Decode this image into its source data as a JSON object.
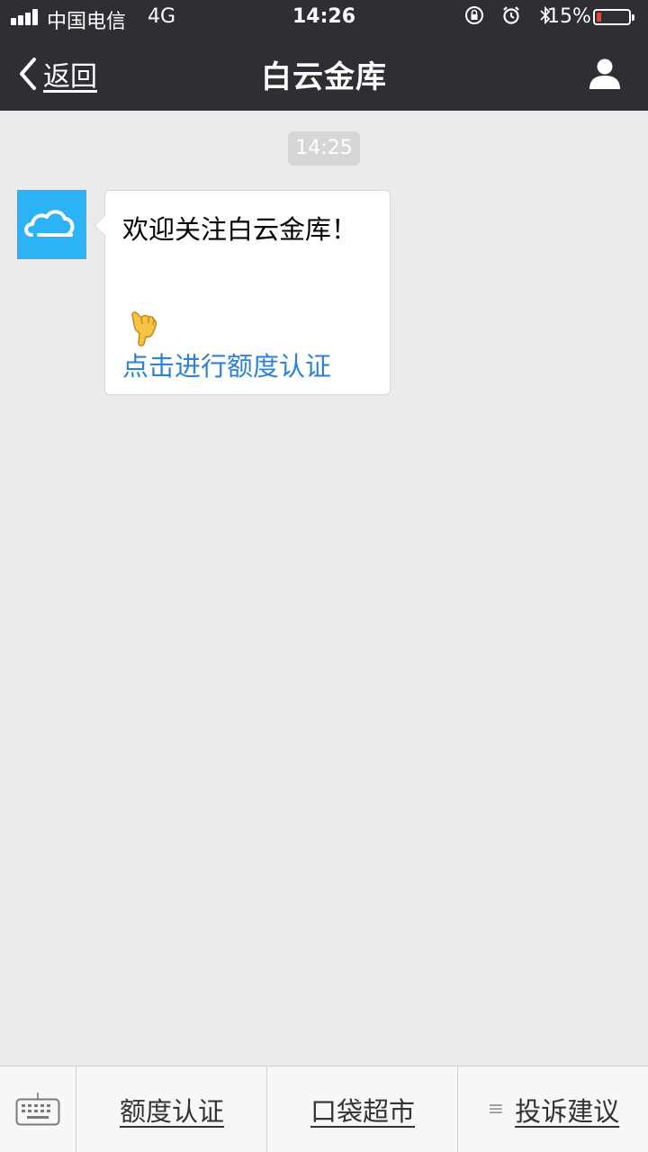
{
  "status_bar": {
    "carrier": "中国电信",
    "network": "4G",
    "time": "14:26",
    "battery_percent_text": "15%",
    "battery_level": 0.15,
    "icons": [
      "orientation-lock-icon",
      "alarm-icon",
      "bluetooth-icon"
    ]
  },
  "nav": {
    "back_label": "返回",
    "title": "白云金库",
    "right_icon": "person-icon"
  },
  "chat": {
    "timestamp": "14:25",
    "message": {
      "avatar_icon": "cloud-icon",
      "text": "欢迎关注白云金库！",
      "emoji": "pointing-down-hand",
      "link_text": "点击进行额度认证"
    }
  },
  "bottom_menu": {
    "keyboard_icon": "keyboard-icon",
    "items": [
      {
        "label": "额度认证",
        "has_submenu": false
      },
      {
        "label": "口袋超市",
        "has_submenu": false
      },
      {
        "label": "投诉建议",
        "has_submenu": true
      }
    ]
  },
  "colors": {
    "header_bg": "#2f2f33",
    "chat_bg": "#ebebeb",
    "link": "#2e82d6",
    "avatar_bg": "#2bb3f5",
    "battery_low": "#ff3b30"
  }
}
